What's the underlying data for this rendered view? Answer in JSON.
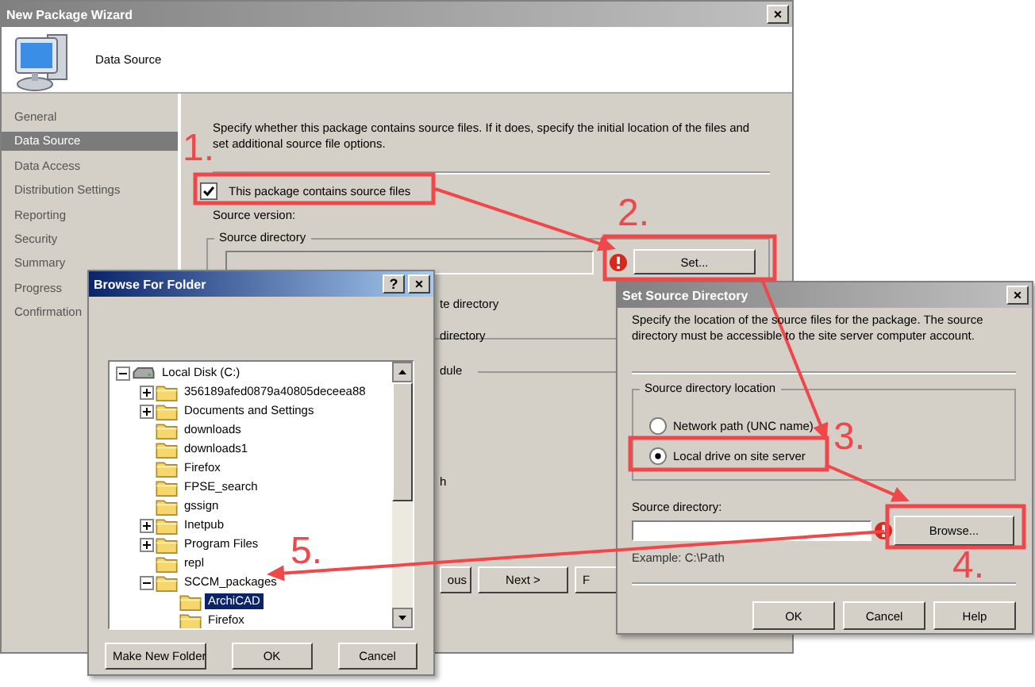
{
  "wizard": {
    "title": "New Package Wizard",
    "page_title": "Data Source",
    "sidebar": [
      {
        "label": "General",
        "selected": false
      },
      {
        "label": "Data Source",
        "selected": true
      },
      {
        "label": "Data Access",
        "selected": false
      },
      {
        "label": "Distribution Settings",
        "selected": false
      },
      {
        "label": "Reporting",
        "selected": false
      },
      {
        "label": "Security",
        "selected": false
      },
      {
        "label": "Summary",
        "selected": false
      },
      {
        "label": "Progress",
        "selected": false
      },
      {
        "label": "Confirmation",
        "selected": false
      }
    ],
    "description": "Specify whether this package contains source files. If it does, specify the initial location of the files and set additional source file options.",
    "contains_source": {
      "label": "This package contains source files",
      "checked": true
    },
    "source_version_label": "Source version:",
    "source_directory_group": "Source directory",
    "set_button": "Set...",
    "partly_hidden_labels": [
      "te directory",
      "directory",
      "dule",
      "h"
    ],
    "nav_buttons": [
      "ous",
      "Next >",
      "F"
    ]
  },
  "browse_dialog": {
    "title": "Browse For Folder",
    "help_button": "?",
    "close_button": "×",
    "tree": [
      {
        "label": "Local Disk (C:)",
        "kind": "drive",
        "expanded": true,
        "selected": false,
        "children": [
          {
            "label": "356189afed0879a40805deceea88",
            "kind": "folder",
            "expanded": false,
            "selected": false
          },
          {
            "label": "Documents and Settings",
            "kind": "folder",
            "expanded": false,
            "selected": false
          },
          {
            "label": "downloads",
            "kind": "folder",
            "selected": false
          },
          {
            "label": "downloads1",
            "kind": "folder",
            "selected": false
          },
          {
            "label": "Firefox",
            "kind": "folder",
            "selected": false
          },
          {
            "label": "FPSE_search",
            "kind": "folder",
            "selected": false
          },
          {
            "label": "gssign",
            "kind": "folder",
            "selected": false
          },
          {
            "label": "Inetpub",
            "kind": "folder",
            "expanded": false,
            "selected": false
          },
          {
            "label": "Program Files",
            "kind": "folder",
            "expanded": false,
            "selected": false
          },
          {
            "label": "repl",
            "kind": "folder",
            "selected": false
          },
          {
            "label": "SCCM_packages",
            "kind": "folder",
            "expanded": true,
            "selected": false,
            "children": [
              {
                "label": "ArchiCAD",
                "kind": "folder",
                "selected": true
              },
              {
                "label": "Firefox",
                "kind": "folder",
                "selected": false
              }
            ]
          }
        ]
      }
    ],
    "buttons": [
      "Make New Folder",
      "OK",
      "Cancel"
    ]
  },
  "set_source_dialog": {
    "title": "Set Source Directory",
    "close_button": "×",
    "description": "Specify the location of the source files for the package. The source directory must be accessible to the site server computer account.",
    "location_group": "Source directory location",
    "options": [
      {
        "label": "Network path (UNC name)",
        "selected": false
      },
      {
        "label": "Local drive on site server",
        "selected": true
      }
    ],
    "source_directory_label": "Source directory:",
    "browse_button": "Browse...",
    "example": "Example: C:\\Path",
    "buttons": [
      "OK",
      "Cancel",
      "Help"
    ]
  },
  "annotations": [
    "1.",
    "2.",
    "3.",
    "4.",
    "5."
  ]
}
